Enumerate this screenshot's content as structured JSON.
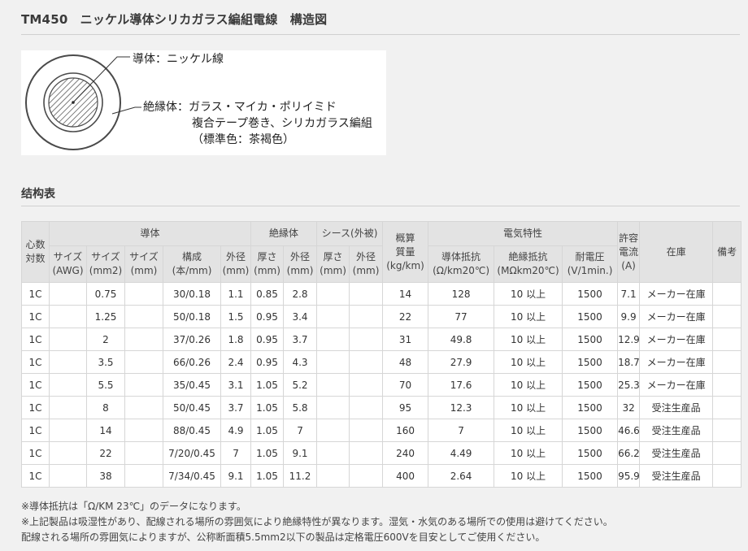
{
  "page": {
    "title": "TM450　ニッケル導体シリカガラス編組電線　構造図"
  },
  "diagram": {
    "conductor_label": "導体：ニッケル線",
    "insulation_line1": "絶縁体：ガラス・マイカ・ポリイミド",
    "insulation_line2": "複合テープ巻き、シリカガラス編組",
    "insulation_line3": "（標準色：茶褐色）"
  },
  "table_section": {
    "title": "结构表"
  },
  "table": {
    "group_headers": {
      "cores": "心数\n対数",
      "conductor": "導体",
      "insulation": "絶縁体",
      "sheath": "シース(外被)",
      "weight": "概算\n質量\n(kg/km)",
      "electrical": "電気特性",
      "current": "許容\n電流\n(A)",
      "stock": "在庫",
      "remarks": "備考"
    },
    "sub_headers": {
      "size_awg": "サイズ\n(AWG)",
      "size_mm2": "サイズ\n(mm2)",
      "size_mm": "サイズ\n(mm)",
      "composition": "構成\n(本/mm)",
      "cond_od": "外径\n(mm)",
      "ins_thick": "厚さ\n(mm)",
      "ins_od": "外径\n(mm)",
      "sh_thick": "厚さ\n(mm)",
      "sh_od": "外径\n(mm)",
      "resistance": "導体抵抗\n(Ω/km20℃)",
      "insulation_res": "絶縁抵抗\n(MΩkm20℃)",
      "voltage": "耐電圧\n(V/1min.)"
    },
    "rows": [
      {
        "cores": "1C",
        "awg": "",
        "mm2": "0.75",
        "mm": "",
        "comp": "30/0.18",
        "cod": "1.1",
        "ith": "0.85",
        "iod": "2.8",
        "sth": "",
        "sod": "",
        "wt": "14",
        "res": "128",
        "ires": "10 以上",
        "volt": "1500",
        "amp": "7.1",
        "stock": "メーカー在庫",
        "note": ""
      },
      {
        "cores": "1C",
        "awg": "",
        "mm2": "1.25",
        "mm": "",
        "comp": "50/0.18",
        "cod": "1.5",
        "ith": "0.95",
        "iod": "3.4",
        "sth": "",
        "sod": "",
        "wt": "22",
        "res": "77",
        "ires": "10 以上",
        "volt": "1500",
        "amp": "9.9",
        "stock": "メーカー在庫",
        "note": ""
      },
      {
        "cores": "1C",
        "awg": "",
        "mm2": "2",
        "mm": "",
        "comp": "37/0.26",
        "cod": "1.8",
        "ith": "0.95",
        "iod": "3.7",
        "sth": "",
        "sod": "",
        "wt": "31",
        "res": "49.8",
        "ires": "10 以上",
        "volt": "1500",
        "amp": "12.9",
        "stock": "メーカー在庫",
        "note": ""
      },
      {
        "cores": "1C",
        "awg": "",
        "mm2": "3.5",
        "mm": "",
        "comp": "66/0.26",
        "cod": "2.4",
        "ith": "0.95",
        "iod": "4.3",
        "sth": "",
        "sod": "",
        "wt": "48",
        "res": "27.9",
        "ires": "10 以上",
        "volt": "1500",
        "amp": "18.7",
        "stock": "メーカー在庫",
        "note": ""
      },
      {
        "cores": "1C",
        "awg": "",
        "mm2": "5.5",
        "mm": "",
        "comp": "35/0.45",
        "cod": "3.1",
        "ith": "1.05",
        "iod": "5.2",
        "sth": "",
        "sod": "",
        "wt": "70",
        "res": "17.6",
        "ires": "10 以上",
        "volt": "1500",
        "amp": "25.3",
        "stock": "メーカー在庫",
        "note": ""
      },
      {
        "cores": "1C",
        "awg": "",
        "mm2": "8",
        "mm": "",
        "comp": "50/0.45",
        "cod": "3.7",
        "ith": "1.05",
        "iod": "5.8",
        "sth": "",
        "sod": "",
        "wt": "95",
        "res": "12.3",
        "ires": "10 以上",
        "volt": "1500",
        "amp": "32",
        "stock": "受注生産品",
        "note": ""
      },
      {
        "cores": "1C",
        "awg": "",
        "mm2": "14",
        "mm": "",
        "comp": "88/0.45",
        "cod": "4.9",
        "ith": "1.05",
        "iod": "7",
        "sth": "",
        "sod": "",
        "wt": "160",
        "res": "7",
        "ires": "10 以上",
        "volt": "1500",
        "amp": "46.6",
        "stock": "受注生産品",
        "note": ""
      },
      {
        "cores": "1C",
        "awg": "",
        "mm2": "22",
        "mm": "",
        "comp": "7/20/0.45",
        "cod": "7",
        "ith": "1.05",
        "iod": "9.1",
        "sth": "",
        "sod": "",
        "wt": "240",
        "res": "4.49",
        "ires": "10 以上",
        "volt": "1500",
        "amp": "66.2",
        "stock": "受注生産品",
        "note": ""
      },
      {
        "cores": "1C",
        "awg": "",
        "mm2": "38",
        "mm": "",
        "comp": "7/34/0.45",
        "cod": "9.1",
        "ith": "1.05",
        "iod": "11.2",
        "sth": "",
        "sod": "",
        "wt": "400",
        "res": "2.64",
        "ires": "10 以上",
        "volt": "1500",
        "amp": "95.9",
        "stock": "受注生産品",
        "note": ""
      }
    ]
  },
  "notes": [
    "※導体抵抗は「Ω/KM 23℃」のデータになります。",
    "※上記製品は吸湿性があり、配線される場所の雰囲気により絶縁特性が異なります。湿気・水気のある場所での使用は避けてください。",
    "配線される場所の雰囲気によりますが、公称断面積5.5mm2以下の製品は定格電圧600Vを目安としてご使用ください。"
  ]
}
